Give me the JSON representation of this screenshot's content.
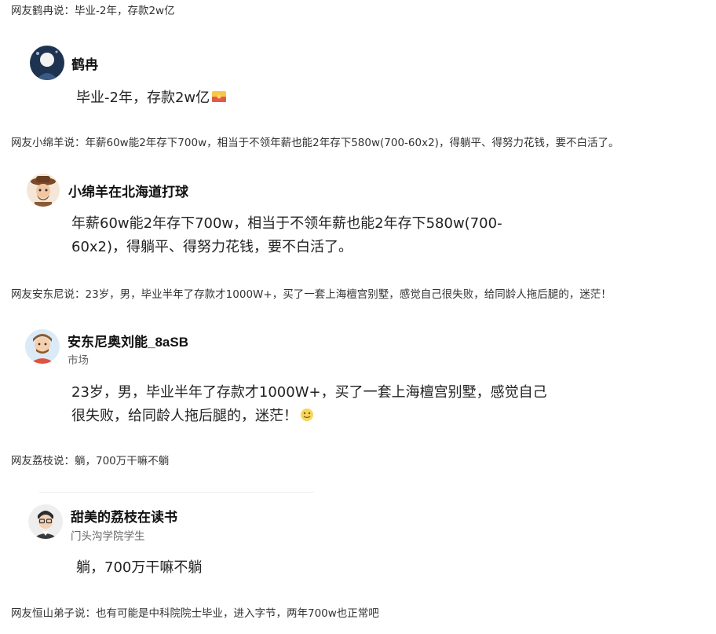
{
  "posts": [
    {
      "caption": "网友鹤冉说：毕业-2年，存款2w亿",
      "author": "鹤冉",
      "subtitle": "",
      "text": "毕业-2年，存款2w亿",
      "emoji": "red-envelope-emoji"
    },
    {
      "caption": "网友小绵羊说：年薪60w能2年存下700w，相当于不领年薪也能2年存下580w(700-60x2)，得躺平、得努力花钱，要不白活了。",
      "author": "小绵羊在北海道打球",
      "subtitle": "",
      "text": "年薪60w能2年存下700w，相当于不领年薪也能2年存下580w(700-60x2)，得躺平、得努力花钱，要不白活了。",
      "emoji": ""
    },
    {
      "caption": "网友安东尼说：23岁，男，毕业半年了存款才1000W+，买了一套上海檀宫别墅，感觉自己很失败，给同龄人拖后腿的，迷茫！",
      "author": "安东尼奥刘能_8aSB",
      "subtitle": "市场",
      "text": "23岁，男，毕业半年了存款才1000W+，买了一套上海檀宫别墅，感觉自己很失败，给同龄人拖后腿的，迷茫！",
      "emoji": "face-emoji"
    },
    {
      "caption": "网友荔枝说：躺，700万干嘛不躺",
      "author": "甜美的荔枝在读书",
      "subtitle": "门头沟学院学生",
      "text": "躺，700万干嘛不躺",
      "emoji": ""
    },
    {
      "caption": "网友恒山弟子说：也有可能是中科院院士毕业，进入字节，两年700w也正常吧",
      "author": "",
      "subtitle": "",
      "text": "",
      "emoji": ""
    }
  ],
  "colors": {
    "text": "#222222",
    "caption": "#333333",
    "subtitle": "#666666",
    "divider": "#ececec"
  }
}
